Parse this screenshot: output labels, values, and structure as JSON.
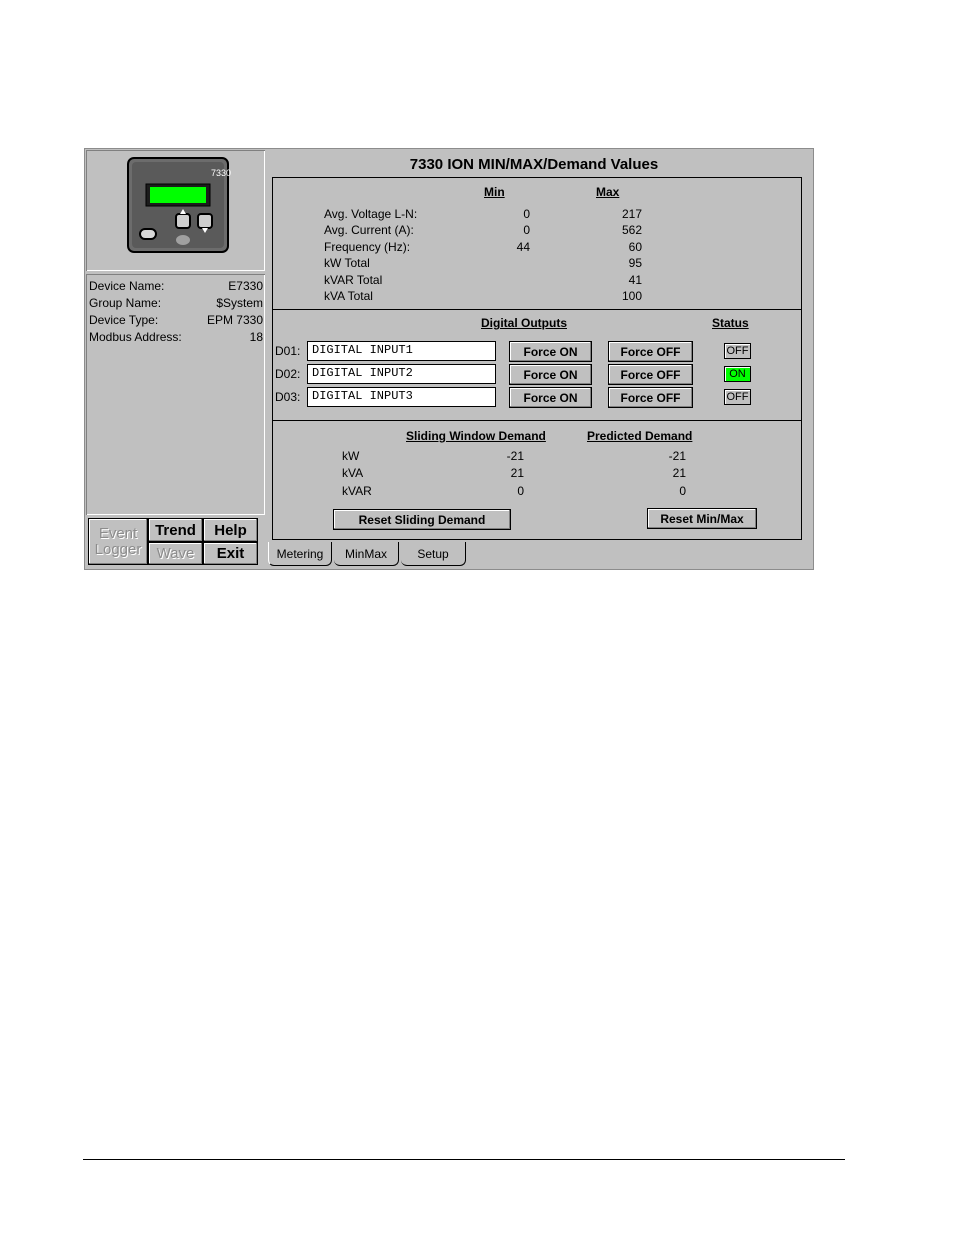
{
  "device_image": {
    "model_label": "7330"
  },
  "device_info": {
    "rows": [
      {
        "label": "Device Name:",
        "value": "E7330"
      },
      {
        "label": "Group Name:",
        "value": "$System"
      },
      {
        "label": "Device Type:",
        "value": "EPM 7330"
      },
      {
        "label": "Modbus Address:",
        "value": "18"
      }
    ]
  },
  "nav": {
    "event_logger": "Event Logger",
    "event": "Event",
    "logger": "Logger",
    "trend": "Trend",
    "help": "Help",
    "wave": "Wave",
    "exit": "Exit"
  },
  "title": "7330 ION MIN/MAX/Demand Values",
  "minmax": {
    "min_header": "Min",
    "max_header": "Max",
    "rows": [
      {
        "label": "Avg. Voltage L-N:",
        "min": "0",
        "max": "217"
      },
      {
        "label": "Avg. Current (A):",
        "min": "0",
        "max": "562"
      },
      {
        "label": "Frequency (Hz):",
        "min": "44",
        "max": "60"
      },
      {
        "label": "kW Total",
        "min": "",
        "max": "95"
      },
      {
        "label": "kVAR Total",
        "min": "",
        "max": "41"
      },
      {
        "label": "kVA Total",
        "min": "",
        "max": "100"
      }
    ]
  },
  "digital_outputs": {
    "header": "Digital Outputs",
    "status_header": "Status",
    "rows": [
      {
        "id": "D01:",
        "value": "DIGITAL INPUT1",
        "force_on": "Force ON",
        "force_off": "Force OFF",
        "status": "OFF"
      },
      {
        "id": "D02:",
        "value": "DIGITAL INPUT2",
        "force_on": "Force ON",
        "force_off": "Force OFF",
        "status": "ON"
      },
      {
        "id": "D03:",
        "value": "DIGITAL INPUT3",
        "force_on": "Force ON",
        "force_off": "Force OFF",
        "status": "OFF"
      }
    ],
    "status_on_color": "#00ff00"
  },
  "demand": {
    "sliding_header": "Sliding Window Demand",
    "predicted_header": "Predicted Demand",
    "rows": [
      {
        "label": "kW",
        "sliding": "-21",
        "predicted": "-21"
      },
      {
        "label": "kVA",
        "sliding": "21",
        "predicted": "21"
      },
      {
        "label": "kVAR",
        "sliding": "0",
        "predicted": "0"
      }
    ],
    "reset_sliding": "Reset Sliding Demand",
    "reset_minmax": "Reset Min/Max"
  },
  "tabs": [
    {
      "label": "Metering"
    },
    {
      "label": "MinMax"
    },
    {
      "label": "Setup"
    }
  ]
}
